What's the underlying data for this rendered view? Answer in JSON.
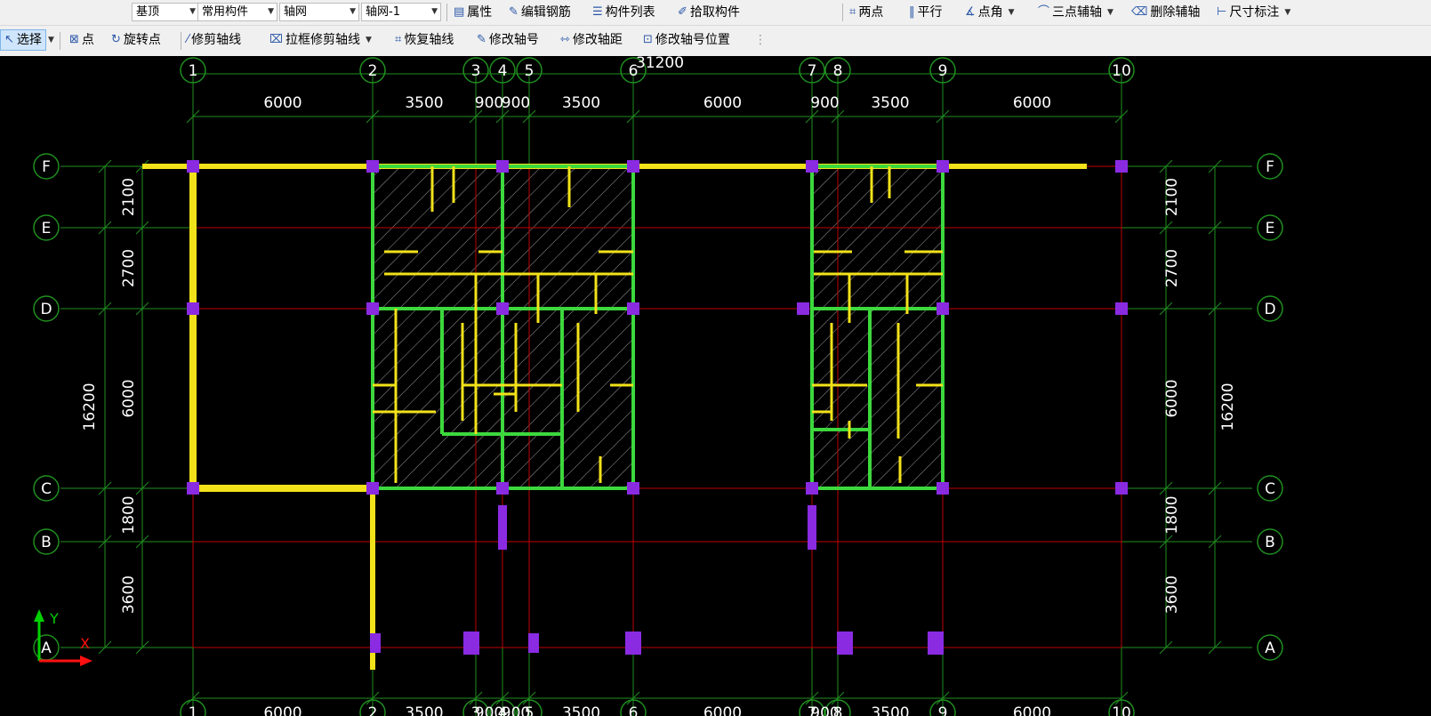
{
  "toolbar1": {
    "floor_combo": "基顶",
    "type_combo": "常用构件",
    "category_combo": "轴网",
    "item_combo": "轴网-1",
    "buttons": {
      "properties": "属性",
      "edit_rebar": "编辑钢筋",
      "component_list": "构件列表",
      "pick_component": "拾取构件",
      "two_points": "两点",
      "parallel": "平行",
      "point_angle": "点角",
      "three_point_aux": "三点辅轴",
      "delete_aux": "删除辅轴",
      "dimension": "尺寸标注"
    }
  },
  "toolbar2": {
    "buttons": {
      "select": "选择",
      "point": "点",
      "rotate_point": "旋转点",
      "trim_axis": "修剪轴线",
      "box_trim_axis": "拉框修剪轴线",
      "restore_axis": "恢复轴线",
      "modify_axis_number": "修改轴号",
      "modify_axis_spacing": "修改轴距",
      "modify_axis_number_position": "修改轴号位置"
    }
  },
  "drawing": {
    "vertical_axes": [
      "1",
      "2",
      "3",
      "4",
      "5",
      "6",
      "7",
      "8",
      "9",
      "10"
    ],
    "horizontal_axes": [
      "F",
      "E",
      "D",
      "C",
      "B",
      "A"
    ],
    "top_segment_dims": [
      "6000",
      "3500",
      "900",
      "900",
      "3500",
      "6000",
      "900",
      "3500",
      "6000"
    ],
    "bottom_segment_dims": [
      "6000",
      "3500",
      "900",
      "900",
      "3500",
      "6000",
      "900",
      "3500",
      "6000"
    ],
    "left_segment_dims": [
      "2100",
      "2700",
      "6000",
      "1800",
      "3600"
    ],
    "right_segment_dims": [
      "2100",
      "2700",
      "6000",
      "1800",
      "3600"
    ],
    "total_horizontal": "31200",
    "total_vertical_left": "16200",
    "total_vertical_right": "16200",
    "ucs_x": "X",
    "ucs_y": "Y"
  },
  "colors": {
    "background": "#000000",
    "dimension_line": "#1f8f1f",
    "axis_line": "#c00000",
    "wall_yellow": "#f2e21a",
    "wall_green": "#3dd83d",
    "column": "#8a2be2",
    "ucs_y": "#00d000",
    "ucs_x": "#ff1010"
  }
}
